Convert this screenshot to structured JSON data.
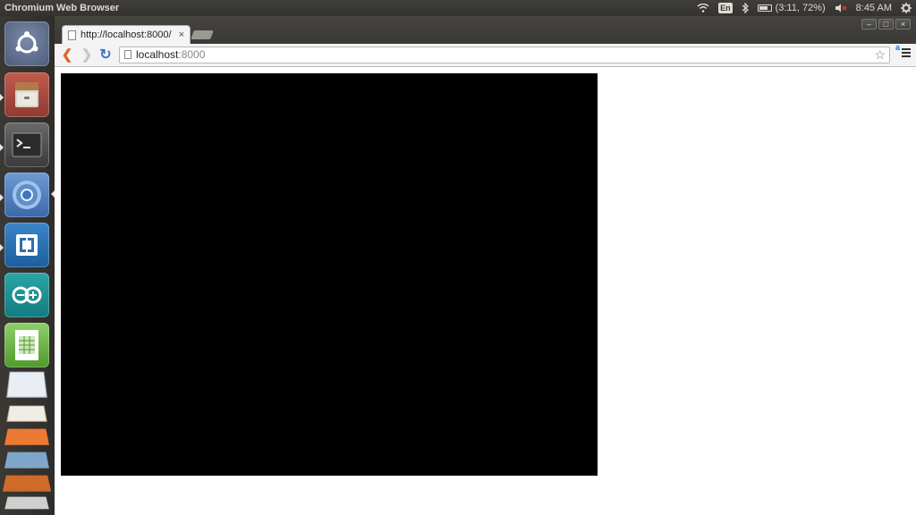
{
  "top_panel": {
    "app_title": "Chromium Web Browser",
    "keyboard_layout": "En",
    "battery_text": "(3:11, 72%)",
    "clock": "8:45 AM"
  },
  "launcher": {
    "items": [
      {
        "name": "ubuntu-dash-icon"
      },
      {
        "name": "files-icon"
      },
      {
        "name": "terminal-icon"
      },
      {
        "name": "chromium-icon"
      },
      {
        "name": "app-icon"
      },
      {
        "name": "arduino-icon"
      },
      {
        "name": "spreadsheet-icon"
      },
      {
        "name": "stacked-apps-icon"
      }
    ]
  },
  "browser": {
    "tab_title": "http://localhost:8000/",
    "tab_close": "×",
    "url_host": "localhost",
    "url_port": ":8000",
    "translate_badge": "a",
    "star_glyph": "☆",
    "back_glyph": "❮",
    "forward_glyph": "❯",
    "reload_glyph": "↻",
    "window_controls": [
      "–",
      "□",
      "×"
    ]
  },
  "colors": {
    "canvas": "#000000",
    "page_bg": "#ffffff",
    "panel_bg": "#3c3b37"
  }
}
